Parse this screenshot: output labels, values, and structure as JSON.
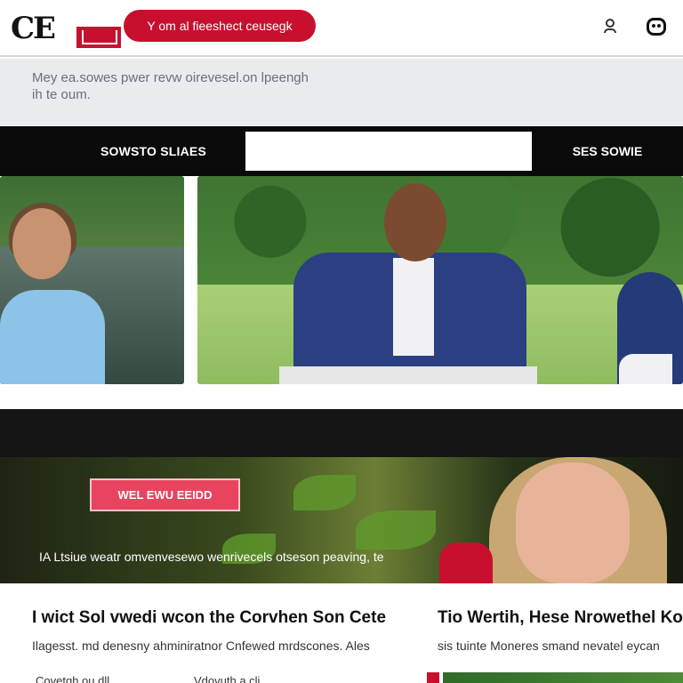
{
  "header": {
    "logo_text": "CE",
    "promo_label": "Y om al fieeshect ceusegk",
    "user_icon": "user-icon",
    "menu_icon": "menu-icon"
  },
  "subheader": {
    "tagline": "Mey ea.sowes pwer revw oirevesel.on lpeengh ih te oum."
  },
  "nav": {
    "left_label": "SOWSTO SLIAES",
    "search_value": "",
    "right_label": "SES SOWIE"
  },
  "banner": {
    "button_label": "WEL EWU EEIDD",
    "caption": "IA Ltsiue weatr omvenvesewo wenrivecels otseson peaving, te"
  },
  "articles": [
    {
      "title": "I wict Sol vwedi wcon the Corvhen Son Cete",
      "subtitle": "Ilagesst. md denesny ahminiratnor Cnfewed mrdscones. Ales"
    },
    {
      "title": "Tio Wertih, Hese Nrowethel Kor",
      "subtitle": "sis tuinte Moneres smand nevatel eycan"
    }
  ],
  "meta_links": [
    "Covetgh ou dll",
    "Vdovuth a.cli"
  ],
  "colors": {
    "brand_red": "#c8102e",
    "nav_black": "#0a0a0a",
    "subheader_grey": "#e9ebef",
    "banner_button": "#e9445f"
  }
}
